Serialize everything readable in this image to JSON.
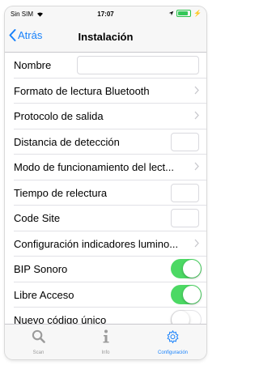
{
  "status": {
    "carrier": "Sin SIM",
    "time": "17:07",
    "battery_level": 0.85
  },
  "nav": {
    "back_label": "Atrás",
    "title": "Instalación"
  },
  "rows": [
    {
      "label": "Nombre",
      "control": "text-field",
      "value": ""
    },
    {
      "label": "Formato de lectura Bluetooth",
      "control": "disclosure"
    },
    {
      "label": "Protocolo de salida",
      "control": "disclosure"
    },
    {
      "label": "Distancia de detección",
      "control": "small-field",
      "value": ""
    },
    {
      "label": "Modo de funcionamiento del lect...",
      "control": "disclosure"
    },
    {
      "label": "Tiempo de relectura",
      "control": "small-field",
      "value": ""
    },
    {
      "label": "Code Site",
      "control": "small-field",
      "value": ""
    },
    {
      "label": "Configuración indicadores lumino...",
      "control": "disclosure"
    },
    {
      "label": "BIP Sonoro",
      "control": "toggle",
      "on": true
    },
    {
      "label": "Libre Acceso",
      "control": "toggle",
      "on": true
    },
    {
      "label": "Nuevo código único",
      "control": "toggle",
      "on": false
    }
  ],
  "tabs": [
    {
      "label": "Scan",
      "icon": "search-icon",
      "active": false
    },
    {
      "label": "Info",
      "icon": "info-icon",
      "active": false
    },
    {
      "label": "Configuración",
      "icon": "gear-icon",
      "active": true
    }
  ],
  "colors": {
    "accent": "#1982fb",
    "toggle_on": "#4cd964",
    "background": "#efeff4"
  }
}
